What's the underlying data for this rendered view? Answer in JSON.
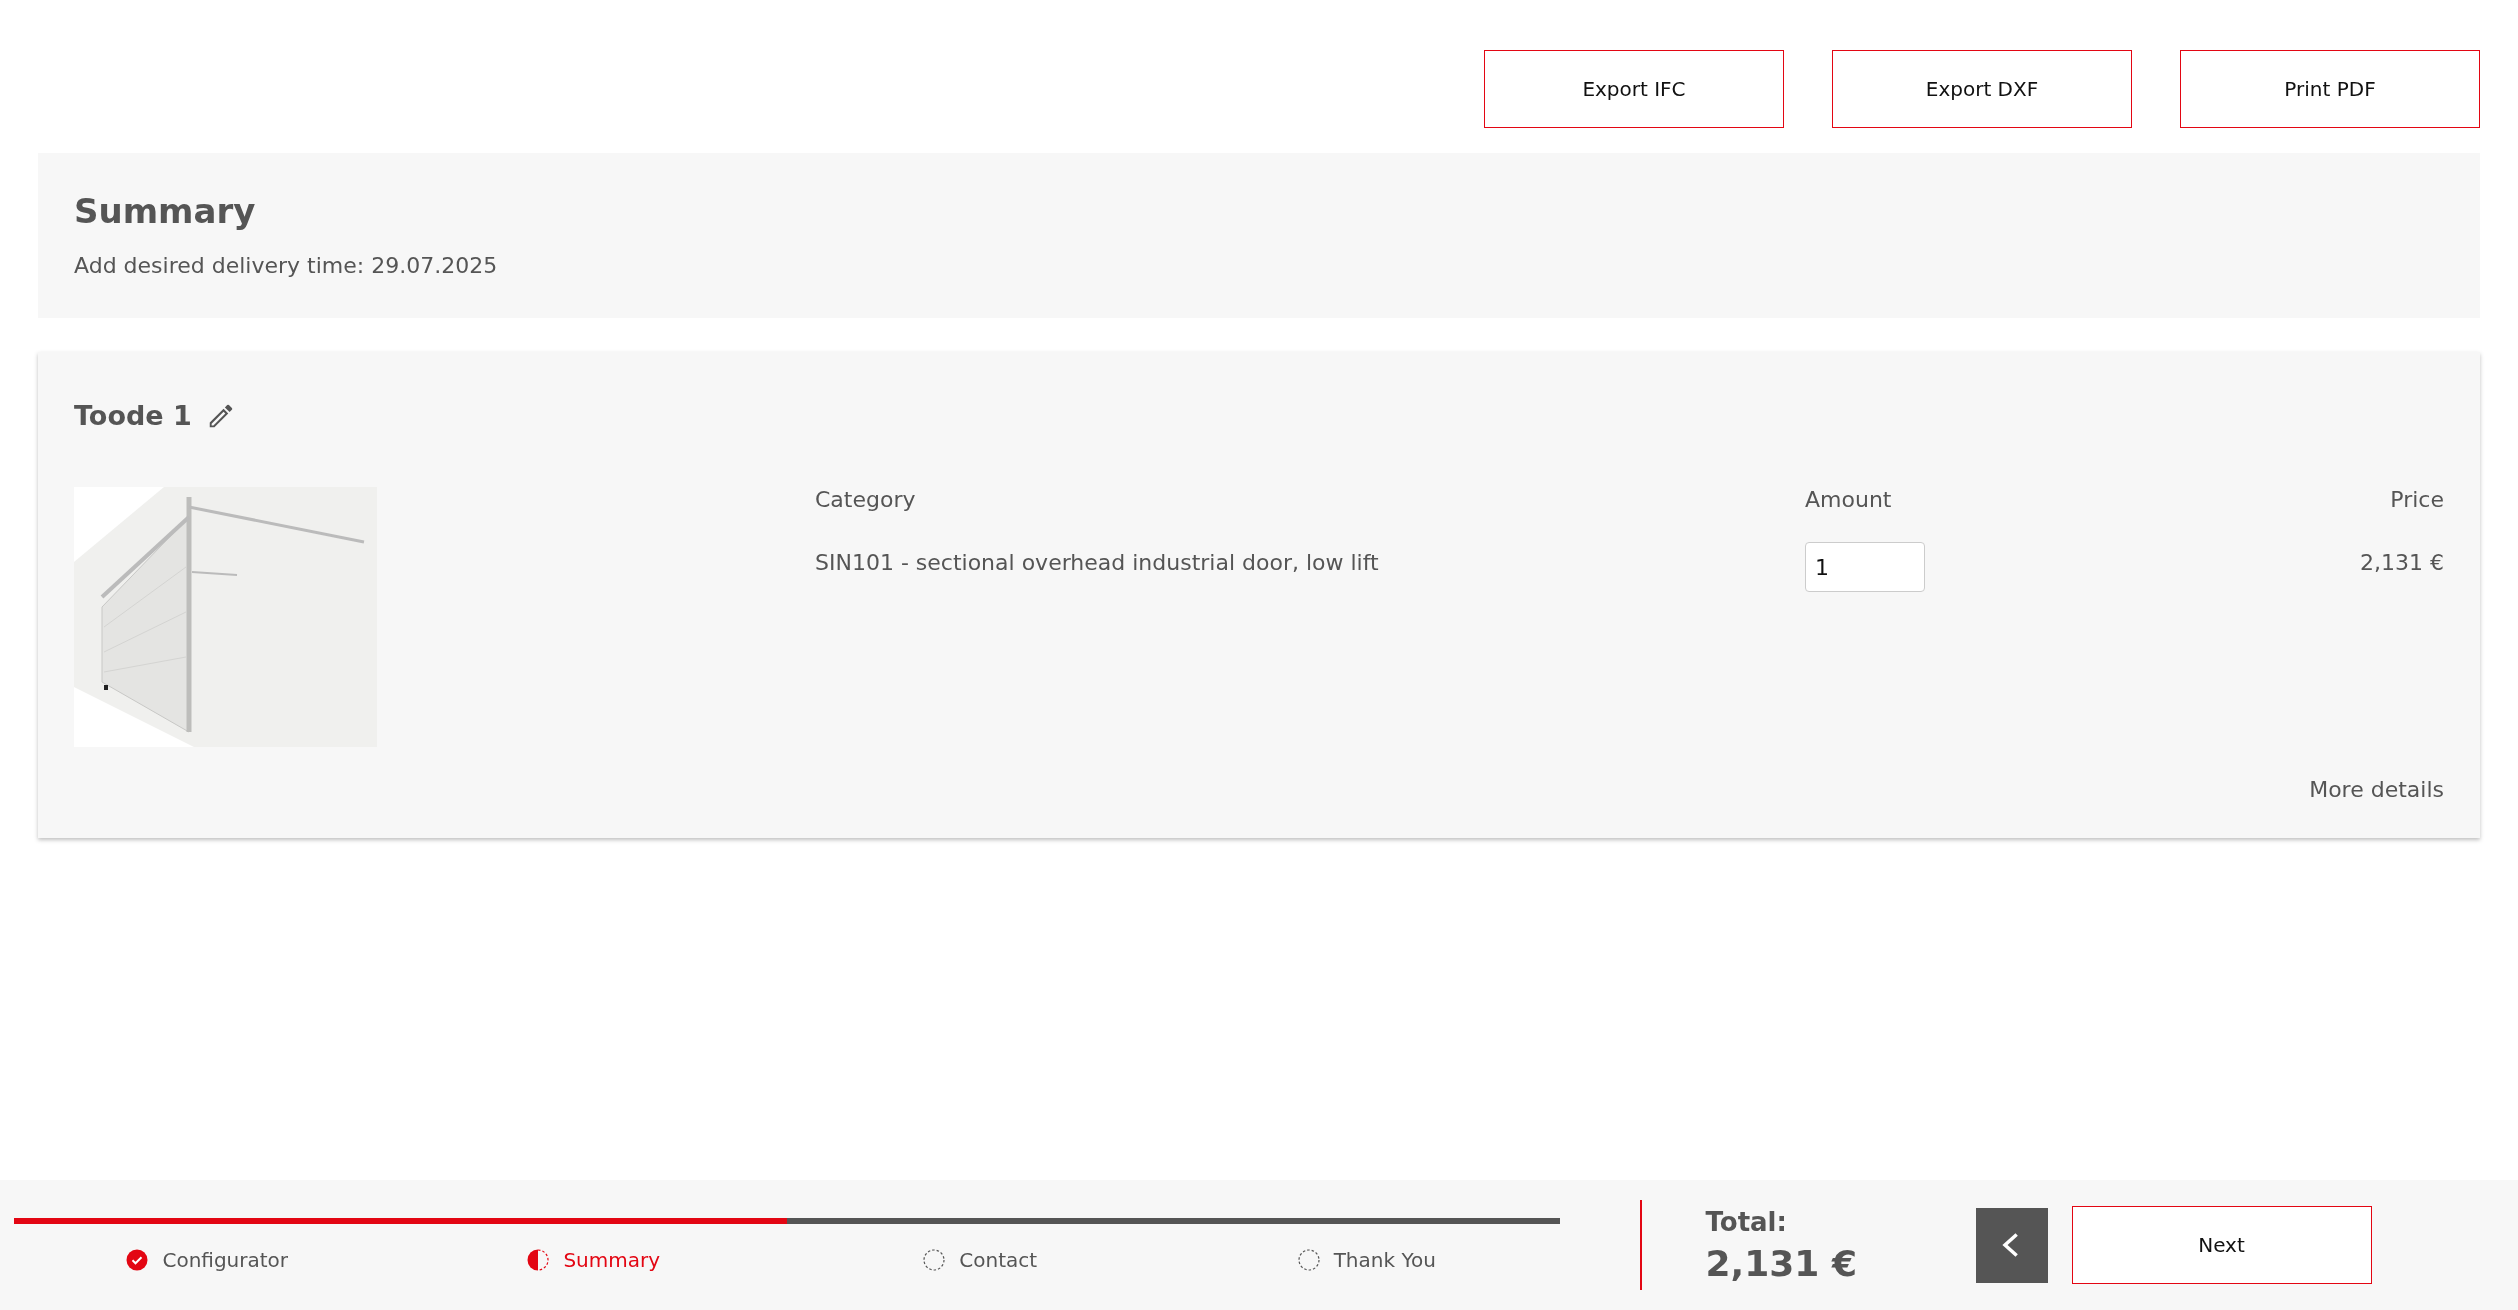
{
  "actions": [
    "Export IFC",
    "Export DXF",
    "Print PDF"
  ],
  "summary": {
    "title": "Summary",
    "delivery": "Add desired delivery time: 29.07.2025"
  },
  "product": {
    "name": "Toode 1",
    "columns": [
      "Category",
      "Amount",
      "Price"
    ],
    "category": "SIN101 - sectional overhead industrial door, low lift",
    "amount": "1",
    "price": "2,131 €",
    "more": "More details"
  },
  "footer": {
    "progress": {
      "level": 0.5
    },
    "steps": [
      {
        "label": "Configurator",
        "kind": "done"
      },
      {
        "label": "Summary",
        "kind": "current"
      },
      {
        "label": "Contact",
        "kind": "pending"
      },
      {
        "label": "Thank You",
        "kind": "pending"
      }
    ],
    "total_label": "Total:",
    "total": "2,131 €",
    "next": "Next"
  }
}
